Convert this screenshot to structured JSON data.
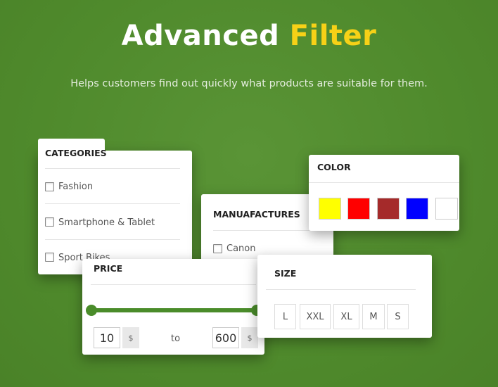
{
  "header": {
    "title_main": "Advanced",
    "title_highlight": "Filter",
    "subtitle": "Helps customers find out quickly what products are suitable for them."
  },
  "categories": {
    "title": "CATEGORIES",
    "items": [
      {
        "label": "Fashion",
        "checked": false
      },
      {
        "label": "Smartphone & Tablet",
        "checked": false
      },
      {
        "label": "Sport Bikes",
        "checked": false
      }
    ]
  },
  "manufactures": {
    "title": "MANUAFACTURES",
    "items": [
      {
        "label": "Canon",
        "checked": false
      }
    ]
  },
  "color": {
    "title": "COLOR",
    "swatches": [
      "#ffff00",
      "#ff0000",
      "#a52a2a",
      "#0000ff",
      "#ffffff"
    ]
  },
  "price": {
    "title": "PRICE",
    "min": "10",
    "max": "600",
    "currency": "$",
    "to_label": "to"
  },
  "size": {
    "title": "SIZE",
    "options": [
      "L",
      "XXL",
      "XL",
      "M",
      "S"
    ]
  },
  "colors": {
    "background": "#4f8a2c",
    "accent": "#f7d117",
    "slider": "#4a8c2a"
  }
}
